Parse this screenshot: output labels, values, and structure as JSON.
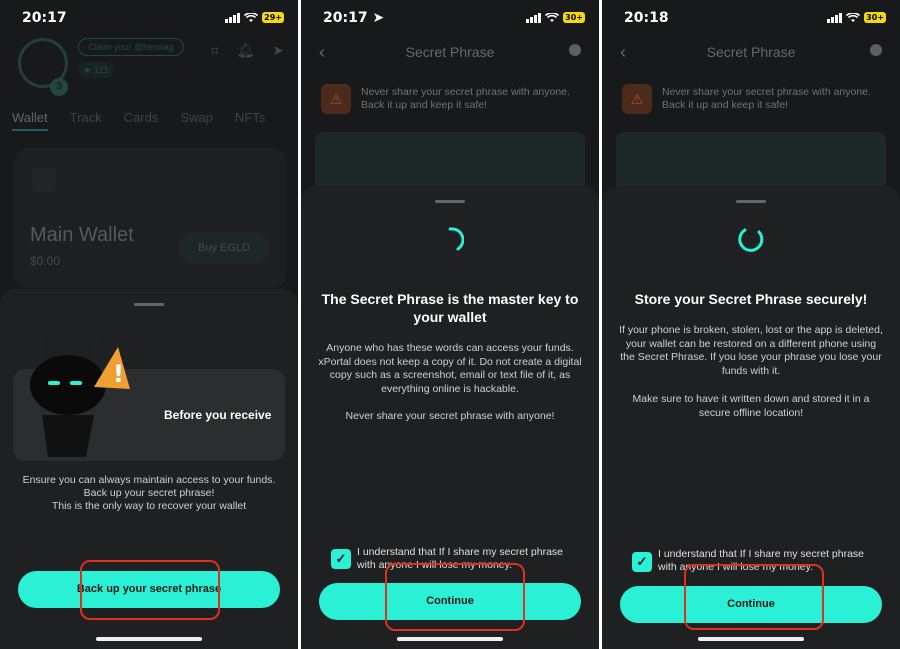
{
  "colors": {
    "accent": "#2af0d5",
    "highlight": "#e0301e",
    "sheet": "#1f2021",
    "background": "#17191a"
  },
  "screen1": {
    "status": {
      "time": "20:17",
      "battery": "29+"
    },
    "header": {
      "claim_label": "Claim your @herotag",
      "score": "121",
      "level": "3"
    },
    "tabs": [
      "Wallet",
      "Track",
      "Cards",
      "Swap",
      "NFTs"
    ],
    "wallet_card": {
      "name": "Main Wallet",
      "balance": "$0.00",
      "buy_label": "Buy EGLD"
    },
    "sheet": {
      "banner_title": "Before you receive",
      "line1": "Ensure you can always maintain access to your funds.",
      "line2": "Back up your secret phrase!",
      "line3": "This is the only way to recover your wallet",
      "button": "Back up your secret phrase"
    }
  },
  "screen2": {
    "status": {
      "time": "20:17",
      "battery": "30+"
    },
    "header": {
      "title": "Secret Phrase"
    },
    "warning": "Never share your secret phrase with anyone. Back it up and keep it safe!",
    "sheet": {
      "title": "The Secret Phrase is the master key to your wallet",
      "body": "Anyone who has these words can access your funds. xPortal does not keep a copy of it. Do not create a digital copy such as a screenshot, email or text file of it, as everything online is hackable.",
      "body2": "Never share your secret phrase with anyone!",
      "checkbox": "I understand that If I share my secret phrase with anyone I will lose my money.",
      "button": "Continue"
    }
  },
  "screen3": {
    "status": {
      "time": "20:18",
      "battery": "30+"
    },
    "header": {
      "title": "Secret Phrase"
    },
    "warning": "Never share your secret phrase with anyone. Back it up and keep it safe!",
    "sheet": {
      "title": "Store your Secret Phrase securely!",
      "body": "If your phone is broken, stolen, lost or the app is deleted, your wallet can be restored on a different phone using the Secret Phrase. If you lose your phrase you lose your funds with it.",
      "body2": "Make sure to have it written down and stored it in a secure offline location!",
      "checkbox": "I understand that If I share my secret phrase with anyone I will lose my money.",
      "button": "Continue"
    }
  }
}
